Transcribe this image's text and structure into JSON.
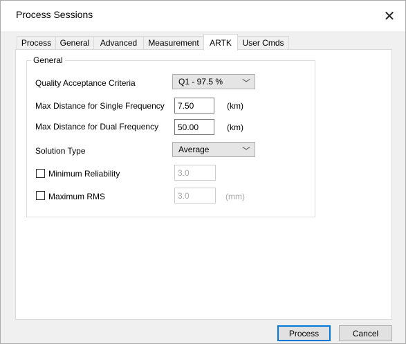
{
  "window": {
    "title": "Process Sessions",
    "close_glyph": "✕"
  },
  "tabs": [
    {
      "label": "Process",
      "active": false
    },
    {
      "label": "General",
      "active": false
    },
    {
      "label": "Advanced",
      "active": false
    },
    {
      "label": "Measurement",
      "active": false
    },
    {
      "label": "ARTK",
      "active": true
    },
    {
      "label": "User Cmds",
      "active": false
    }
  ],
  "group": {
    "title": "General",
    "quality": {
      "label": "Quality Acceptance Criteria",
      "value": "Q1 - 97.5 %"
    },
    "max_single": {
      "label": "Max Distance for Single Frequency",
      "value": "7.50",
      "unit": "(km)"
    },
    "max_dual": {
      "label": "Max Distance for Dual Frequency",
      "value": "50.00",
      "unit": "(km)"
    },
    "solution": {
      "label": "Solution Type",
      "value": "Average"
    },
    "min_reliability": {
      "label": "Minimum Reliability",
      "checked": false,
      "value": "3.0"
    },
    "max_rms": {
      "label": "Maximum RMS",
      "checked": false,
      "value": "3.0",
      "unit": "(mm)"
    }
  },
  "buttons": {
    "process": "Process",
    "cancel": "Cancel"
  },
  "icons": {
    "chevron": "﹀"
  }
}
